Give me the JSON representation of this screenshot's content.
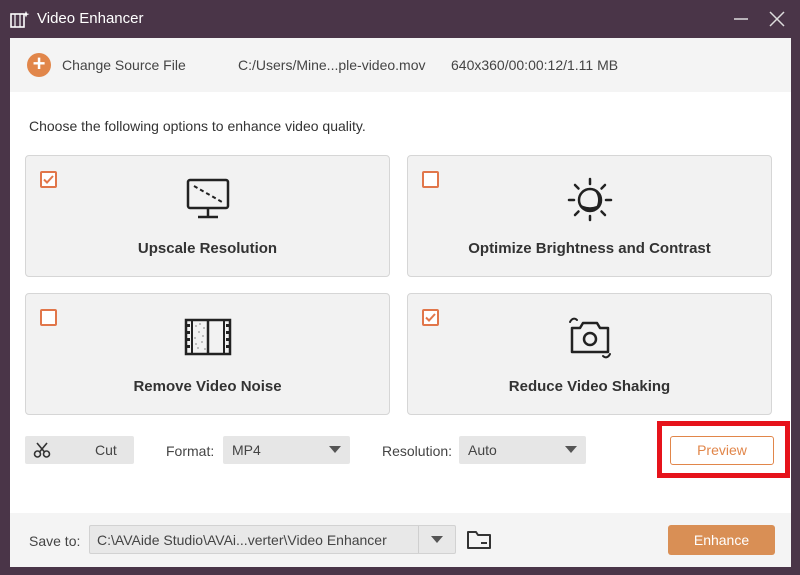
{
  "window": {
    "title": "Video Enhancer"
  },
  "source": {
    "change_label": "Change Source File",
    "path": "C:/Users/Mine...ple-video.mov",
    "meta": "640x360/00:00:12/1.11 MB"
  },
  "instruction": "Choose the following options to enhance video quality.",
  "options": [
    {
      "label": "Upscale Resolution",
      "checked": true,
      "icon": "monitor-upscale-icon"
    },
    {
      "label": "Optimize Brightness and Contrast",
      "checked": false,
      "icon": "brightness-icon"
    },
    {
      "label": "Remove Video Noise",
      "checked": false,
      "icon": "film-noise-icon"
    },
    {
      "label": "Reduce Video Shaking",
      "checked": true,
      "icon": "camera-shake-icon"
    }
  ],
  "toolbar": {
    "cut_label": "Cut",
    "format_label": "Format:",
    "format_value": "MP4",
    "resolution_label": "Resolution:",
    "resolution_value": "Auto",
    "preview_label": "Preview"
  },
  "footer": {
    "save_label": "Save to:",
    "save_path": "C:\\AVAide Studio\\AVAi...verter\\Video Enhancer",
    "enhance_label": "Enhance"
  },
  "colors": {
    "accent": "#e1864a",
    "title_bar": "#4a3548",
    "highlight": "#e6131b"
  }
}
